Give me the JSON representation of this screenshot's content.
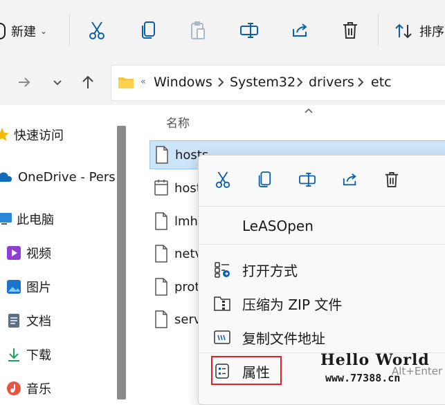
{
  "toolbar": {
    "new_label": "新建",
    "sort_label": "排序"
  },
  "address": {
    "crumbs": [
      "Windows",
      "System32",
      "drivers",
      "etc"
    ]
  },
  "columns": {
    "name_header": "名称"
  },
  "nav": {
    "items": [
      {
        "label": "快速访问"
      },
      {
        "label": "OneDrive - Pers"
      },
      {
        "label": "此电脑"
      },
      {
        "label": "视频"
      },
      {
        "label": "图片"
      },
      {
        "label": "文档"
      },
      {
        "label": "下载"
      },
      {
        "label": "音乐"
      }
    ]
  },
  "files": [
    {
      "name": "hosts"
    },
    {
      "name": "host"
    },
    {
      "name": "lmh"
    },
    {
      "name": "netv"
    },
    {
      "name": "prot"
    },
    {
      "name": "serv"
    }
  ],
  "context_menu": {
    "items": [
      {
        "label": "LeASOpen"
      },
      {
        "label": "打开方式"
      },
      {
        "label": "压缩为 ZIP 文件"
      },
      {
        "label": "复制文件地址"
      },
      {
        "label": "属性"
      }
    ],
    "properties_shortcut": "Alt+Enter"
  },
  "watermark": {
    "title": "Hello World",
    "url": "www.77388.cn"
  },
  "colors": {
    "accent": "#0067c0",
    "selection": "#cce4f7",
    "highlight_box": "#e0212b"
  }
}
